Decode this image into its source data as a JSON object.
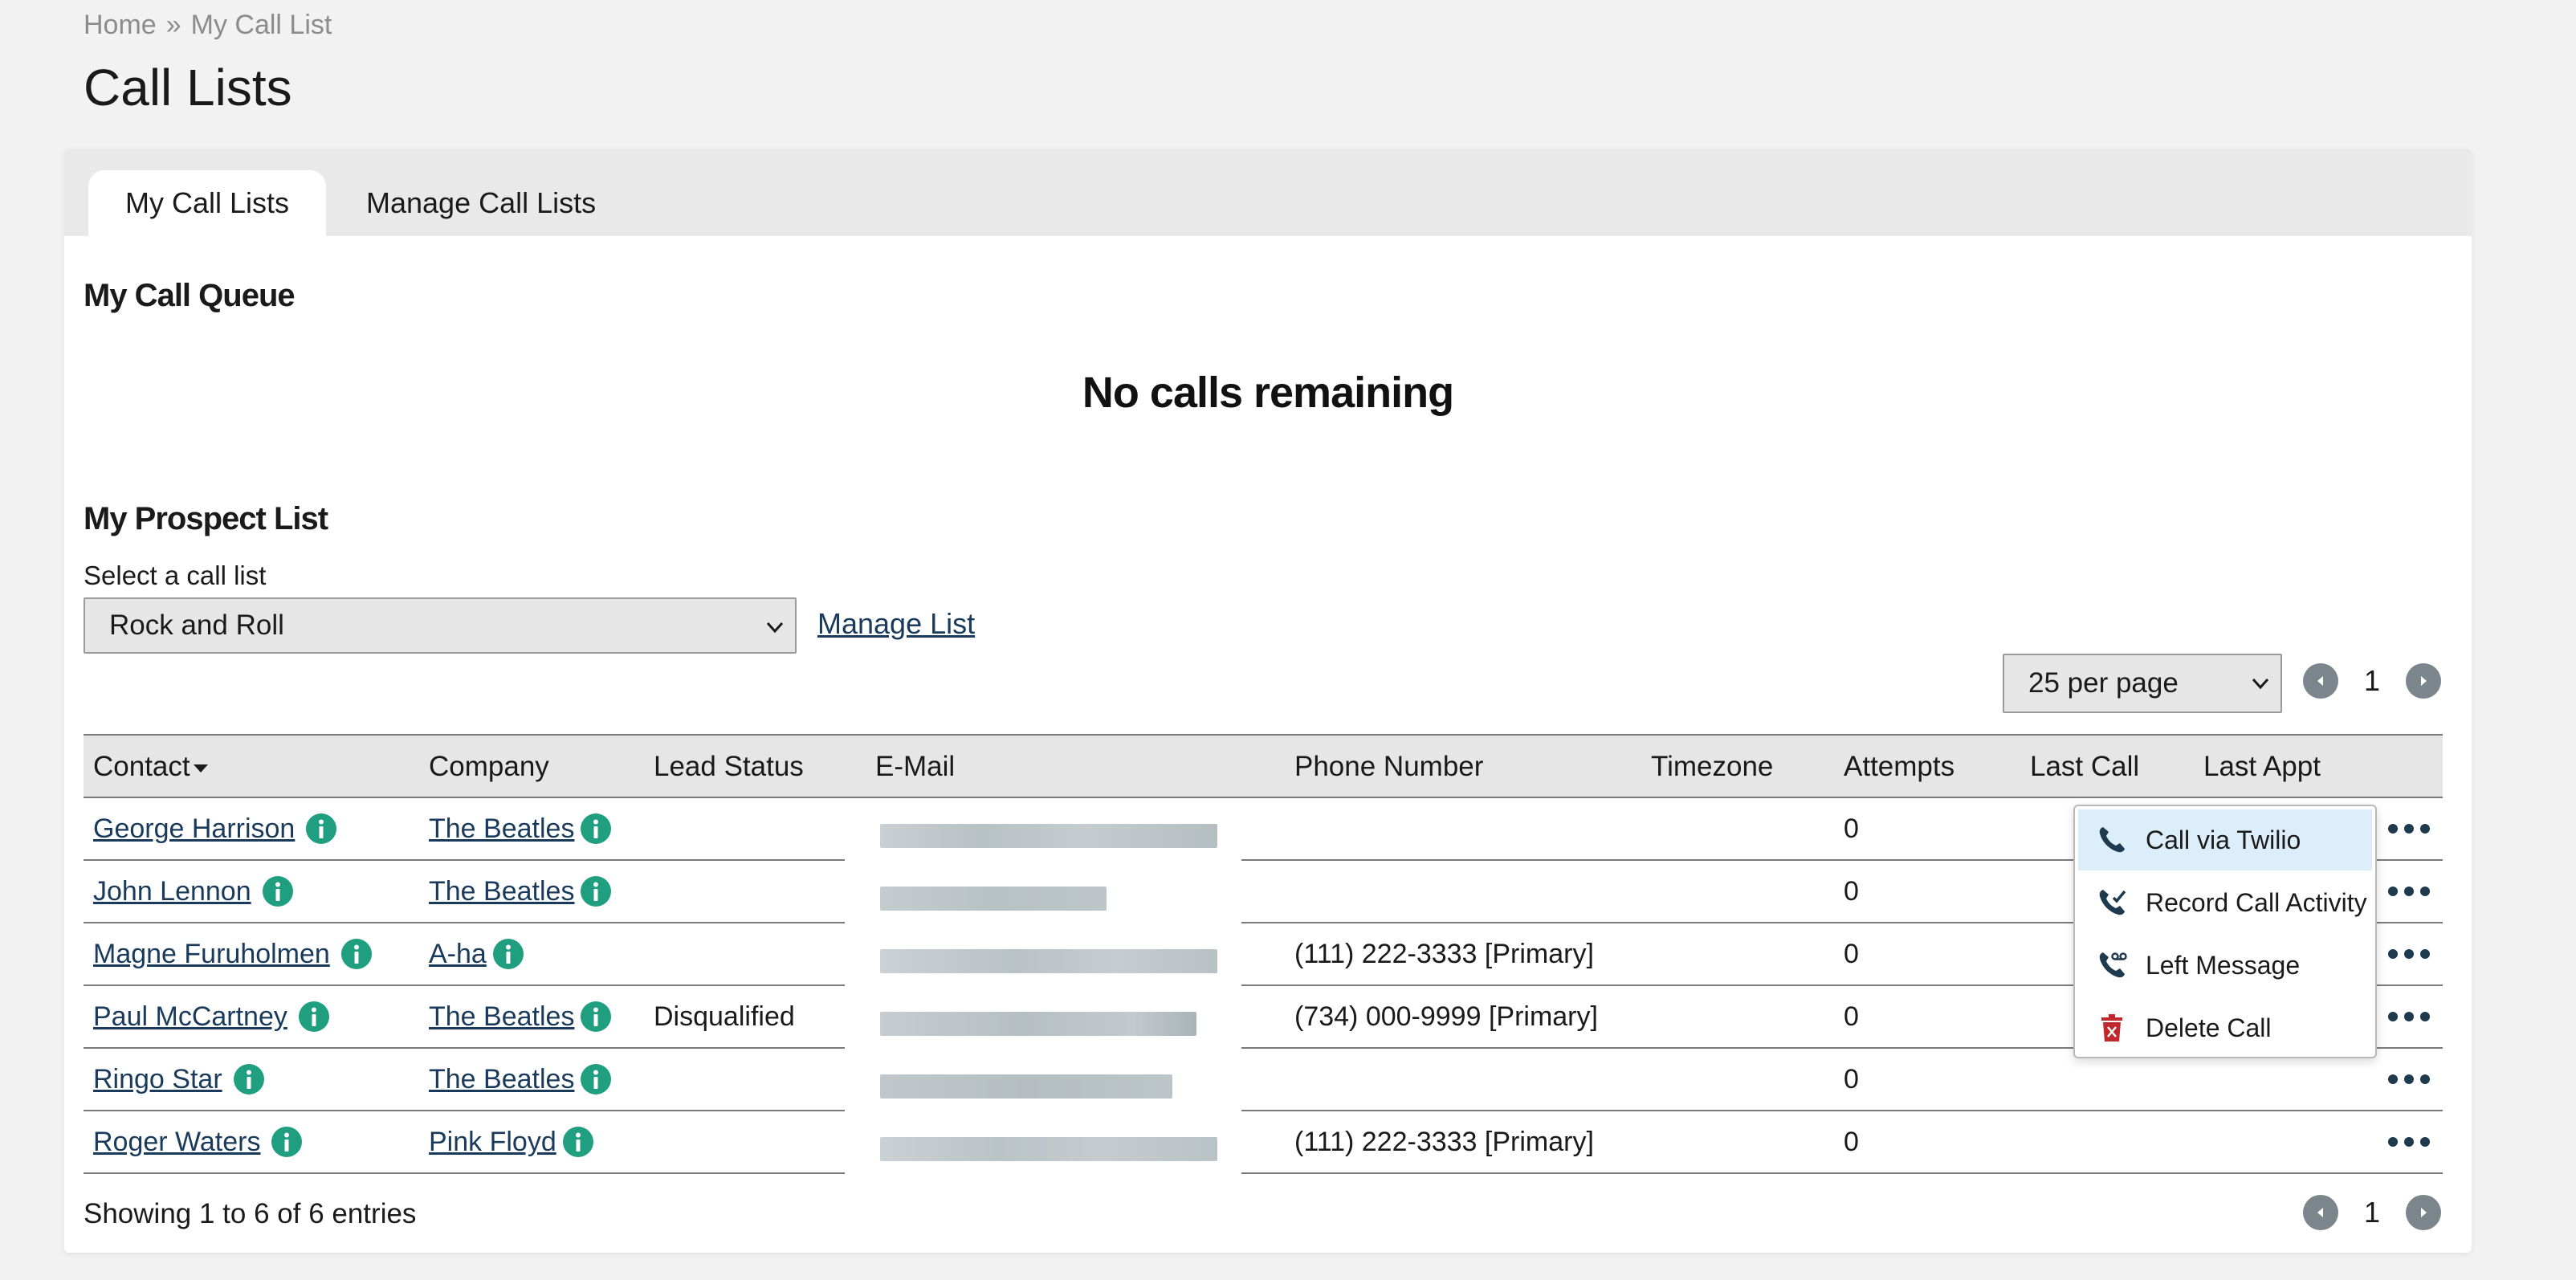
{
  "breadcrumb": {
    "home": "Home",
    "separator": "»",
    "current": "My Call List"
  },
  "page_title": "Call Lists",
  "tabs": [
    {
      "label": "My Call Lists",
      "active": true
    },
    {
      "label": "Manage Call Lists",
      "active": false
    }
  ],
  "queue": {
    "title": "My Call Queue",
    "empty_message": "No calls remaining"
  },
  "prospect": {
    "title": "My Prospect List",
    "select_label": "Select a call list",
    "selected_list": "Rock and Roll",
    "manage_link": "Manage List"
  },
  "pagination": {
    "per_page": "25 per page",
    "page": "1"
  },
  "table": {
    "columns": [
      "Contact",
      "Company",
      "Lead Status",
      "E-Mail",
      "Phone Number",
      "Timezone",
      "Attempts",
      "Last Call",
      "Last Appt"
    ],
    "sorted_column": "Contact",
    "rows": [
      {
        "contact": "George Harrison",
        "company": "The Beatles",
        "lead_status": "",
        "phone": "",
        "timezone": "",
        "attempts": "0"
      },
      {
        "contact": "John Lennon",
        "company": "The Beatles",
        "lead_status": "",
        "phone": "",
        "timezone": "",
        "attempts": "0"
      },
      {
        "contact": "Magne Furuholmen",
        "company": "A-ha",
        "lead_status": "",
        "phone": "(111) 222-3333 [Primary]",
        "timezone": "",
        "attempts": "0"
      },
      {
        "contact": "Paul McCartney",
        "company": "The Beatles",
        "lead_status": "Disqualified",
        "phone": "(734) 000-9999 [Primary]",
        "timezone": "",
        "attempts": "0"
      },
      {
        "contact": "Ringo Star",
        "company": "The Beatles",
        "lead_status": "",
        "phone": "",
        "timezone": "",
        "attempts": "0"
      },
      {
        "contact": "Roger Waters",
        "company": "Pink Floyd",
        "lead_status": "",
        "phone": "(111) 222-3333 [Primary]",
        "timezone": "",
        "attempts": "0"
      }
    ]
  },
  "footer": {
    "info": "Showing 1 to 6 of 6 entries"
  },
  "context_menu": {
    "items": [
      {
        "label": "Call via Twilio",
        "icon": "phone-icon"
      },
      {
        "label": "Record Call Activity",
        "icon": "record-call-icon"
      },
      {
        "label": "Left Message",
        "icon": "voicemail-icon"
      },
      {
        "label": "Delete Call",
        "icon": "trash-icon"
      }
    ]
  },
  "colors": {
    "info_icon": "#1f9e80",
    "link": "#1a3a5c",
    "menu_hover": "#dceefa",
    "delete_icon": "#c0282d",
    "phone_icon": "#1e3a4f"
  }
}
